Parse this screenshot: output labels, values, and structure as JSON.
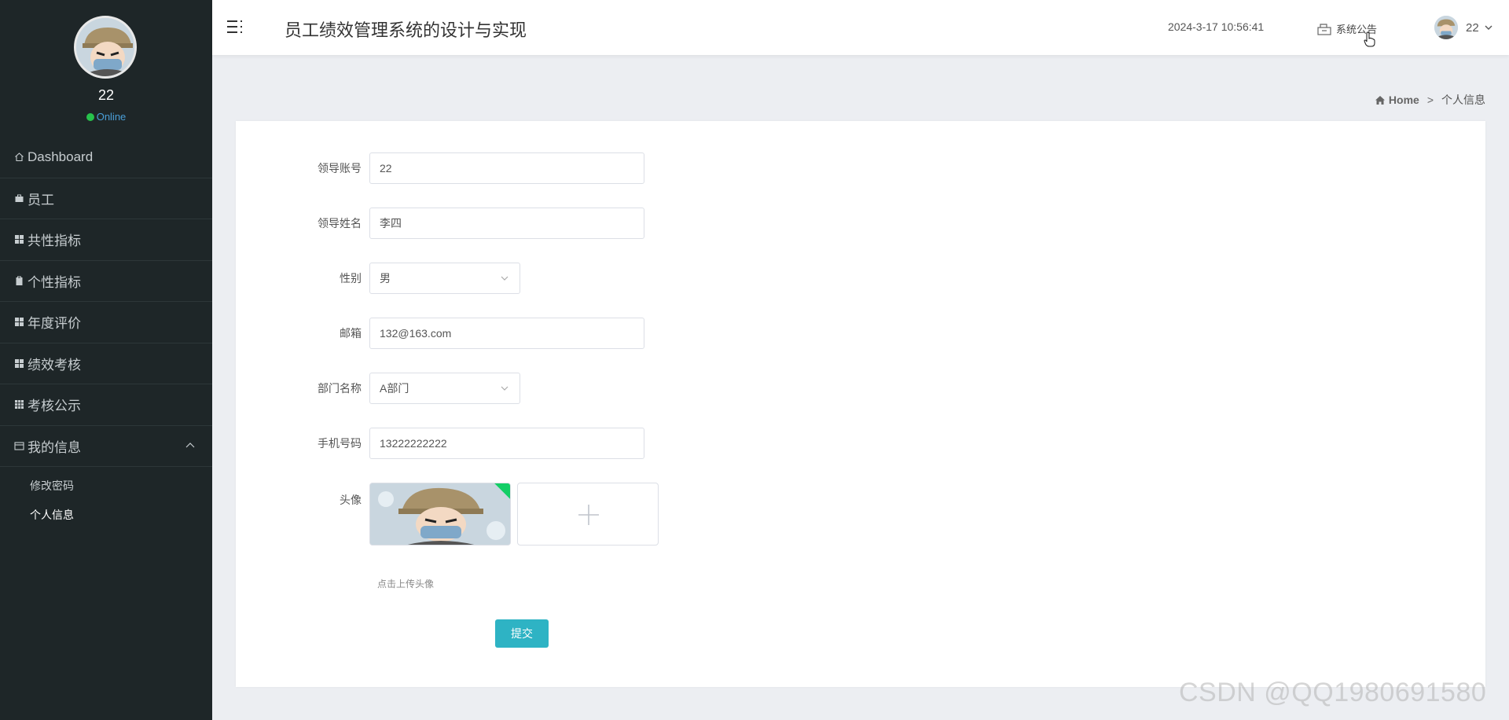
{
  "sidebar": {
    "user": {
      "name": "22",
      "status": "Online"
    },
    "menu": [
      {
        "label": "Dashboard"
      },
      {
        "label": "员工"
      },
      {
        "label": "共性指标"
      },
      {
        "label": "个性指标"
      },
      {
        "label": "年度评价"
      },
      {
        "label": "绩效考核"
      },
      {
        "label": "考核公示"
      },
      {
        "label": "我的信息"
      }
    ],
    "submenu": [
      {
        "label": "修改密码"
      },
      {
        "label": "个人信息"
      }
    ]
  },
  "header": {
    "title": "员工绩效管理系统的设计与实现",
    "datetime": "2024-3-17 10:56:41",
    "notice": "系统公告",
    "user_name": "22"
  },
  "breadcrumb": {
    "home": "Home",
    "sep": ">",
    "current": "个人信息"
  },
  "form": {
    "fields": [
      {
        "label": "领导账号",
        "value": "22"
      },
      {
        "label": "领导姓名",
        "value": "李四"
      },
      {
        "label": "性别",
        "value": "男"
      },
      {
        "label": "邮箱",
        "value": "132@163.com"
      },
      {
        "label": "部门名称",
        "value": "A部门"
      },
      {
        "label": "手机号码",
        "value": "13222222222"
      }
    ],
    "avatar_label": "头像",
    "upload_hint": "点击上传头像",
    "submit_label": "提交"
  },
  "watermark": "CSDN @QQ1980691580",
  "colors": {
    "sidebar_bg": "#1e2628",
    "accent": "#2eb3c4",
    "online": "#27c24c"
  }
}
